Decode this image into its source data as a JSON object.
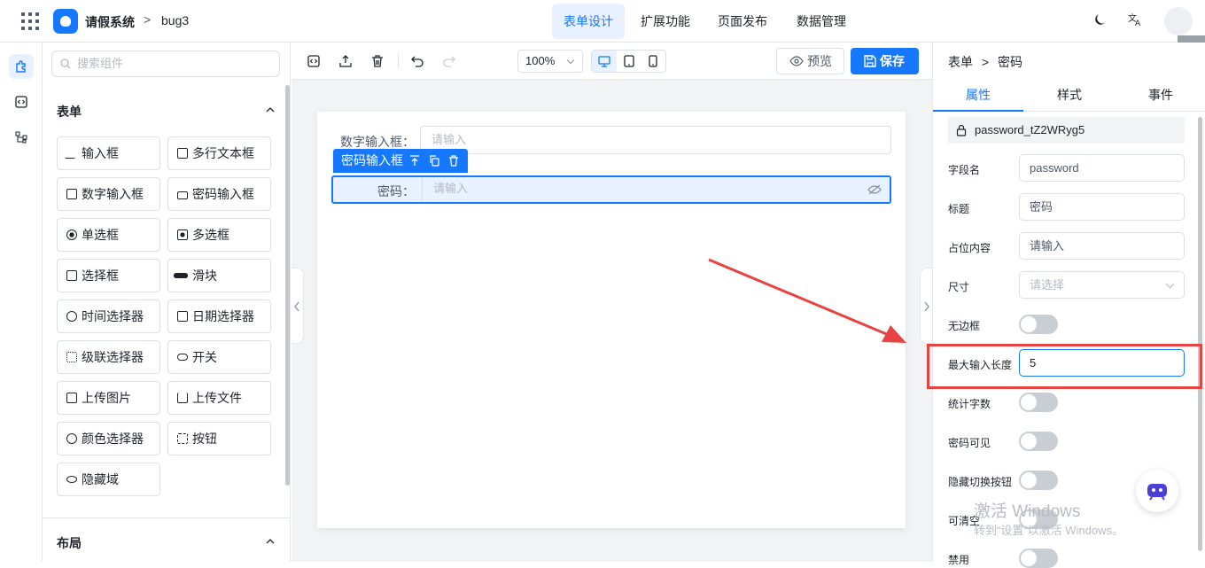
{
  "header": {
    "app_name": "请假系统",
    "separator": ">",
    "project": "bug3",
    "tabs": [
      {
        "label": "表单设计",
        "active": true
      },
      {
        "label": "扩展功能",
        "active": false
      },
      {
        "label": "页面发布",
        "active": false
      },
      {
        "label": "数据管理",
        "active": false
      }
    ],
    "right_icons": [
      "moon-icon",
      "translate-icon",
      "avatar"
    ]
  },
  "palette": {
    "search_placeholder": "搜索组件",
    "sections": [
      {
        "title": "表单",
        "items": [
          "输入框",
          "多行文本框",
          "数字输入框",
          "密码输入框",
          "单选框",
          "多选框",
          "选择框",
          "滑块",
          "时间选择器",
          "日期选择器",
          "级联选择器",
          "开关",
          "上传图片",
          "上传文件",
          "颜色选择器",
          "按钮",
          "隐藏域"
        ]
      },
      {
        "title": "布局",
        "items": []
      }
    ]
  },
  "toolbar": {
    "zoom": "100%",
    "preview_label": "预览",
    "save_label": "保存"
  },
  "form": {
    "fields": [
      {
        "label": "数字输入框：",
        "placeholder": "请输入"
      },
      {
        "label": "密码：",
        "placeholder": "请输入"
      }
    ],
    "selected_tag": "密码输入框"
  },
  "props": {
    "breadcrumb": {
      "root": "表单",
      "sep": ">",
      "current": "密码"
    },
    "tabs": [
      {
        "label": "属性",
        "active": true
      },
      {
        "label": "样式",
        "active": false
      },
      {
        "label": "事件",
        "active": false
      }
    ],
    "component_id": "password_tZ2WRyg5",
    "rows": [
      {
        "label": "字段名",
        "type": "input",
        "value": "password"
      },
      {
        "label": "标题",
        "type": "input",
        "value": "密码"
      },
      {
        "label": "占位内容",
        "type": "input",
        "value": "请输入"
      },
      {
        "label": "尺寸",
        "type": "select",
        "value": "请选择"
      },
      {
        "label": "无边框",
        "type": "toggle",
        "value": false
      },
      {
        "label": "最大输入长度",
        "type": "input",
        "value": "5"
      },
      {
        "label": "统计字数",
        "type": "toggle",
        "value": false
      },
      {
        "label": "密码可见",
        "type": "toggle",
        "value": false
      },
      {
        "label": "隐藏切换按钮",
        "type": "toggle",
        "value": false
      },
      {
        "label": "可清空",
        "type": "toggle",
        "value": false
      },
      {
        "label": "禁用",
        "type": "toggle",
        "value": false
      }
    ]
  },
  "watermark": {
    "line1": "激活 Windows",
    "line2": "转到“设置”以激活 Windows。"
  },
  "colors": {
    "accent": "#1677ff",
    "highlight": "#e84343"
  }
}
